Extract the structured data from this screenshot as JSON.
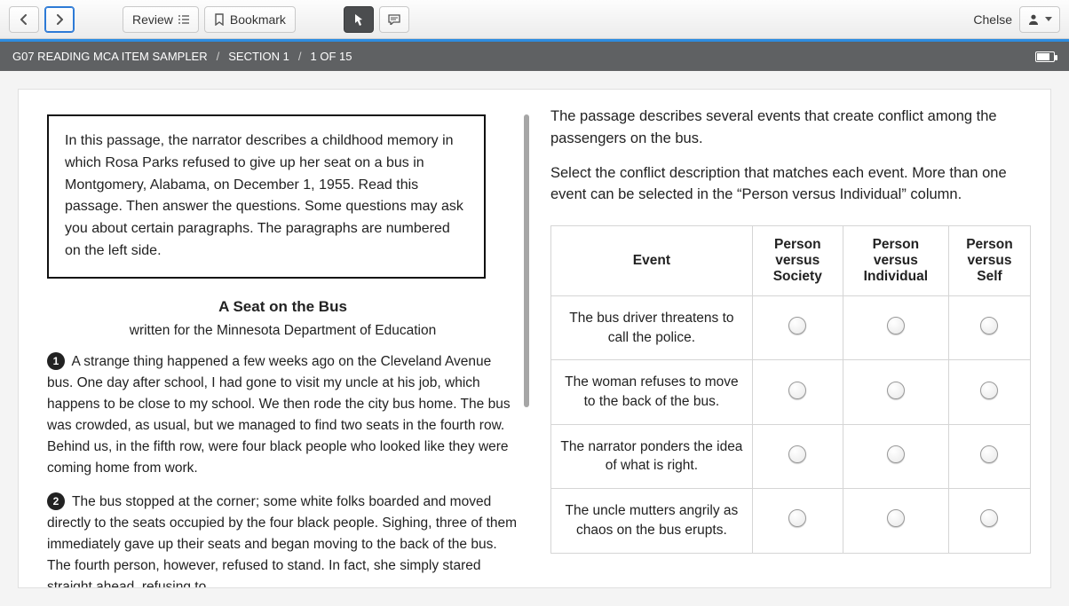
{
  "toolbar": {
    "review_label": "Review",
    "bookmark_label": "Bookmark",
    "username": "Chelse"
  },
  "sectionbar": {
    "test_name": "G07 READING MCA ITEM SAMPLER",
    "section_label": "SECTION 1",
    "position_label": "1 OF 15"
  },
  "passage": {
    "intro": "In this passage, the narrator describes a childhood memory in which Rosa Parks refused to give up her seat on a bus in Montgomery, Alabama, on December 1, 1955. Read this passage. Then answer the questions. Some questions may ask you about certain paragraphs. The paragraphs are numbered on the left side.",
    "title": "A Seat on the Bus",
    "subtitle": "written for the Minnesota Department of Education",
    "para1_num": "1",
    "para1": "A strange thing happened a few weeks ago on the Cleveland Avenue bus. One day after school, I had gone to visit my uncle at his job, which happens to be close to my school. We then rode the city bus home. The bus was crowded, as usual, but we managed to find two seats in the fourth row. Behind us, in the fifth row, were four black people who looked like they were coming home from work.",
    "para2_num": "2",
    "para2": "The bus stopped at the corner; some white folks boarded and moved directly to the seats occupied by the four black people. Sighing, three of them immediately gave up their seats and began moving to the back of the bus. The fourth person, however, refused to stand. In fact, she simply stared straight ahead, refusing to"
  },
  "question": {
    "stem": "The passage describes several events that create conflict among the passengers on the bus.",
    "instruction": "Select the conflict description that matches each event. More than one event can be selected in the “Person versus Individual” column.",
    "col_event": "Event",
    "cols": [
      "Person versus Society",
      "Person versus Individual",
      "Person versus Self"
    ],
    "events": [
      "The bus driver threatens to call the police.",
      "The woman refuses to move to the back of the bus.",
      "The narrator ponders the idea of what is right.",
      "The uncle mutters angrily as chaos on the bus erupts."
    ]
  }
}
